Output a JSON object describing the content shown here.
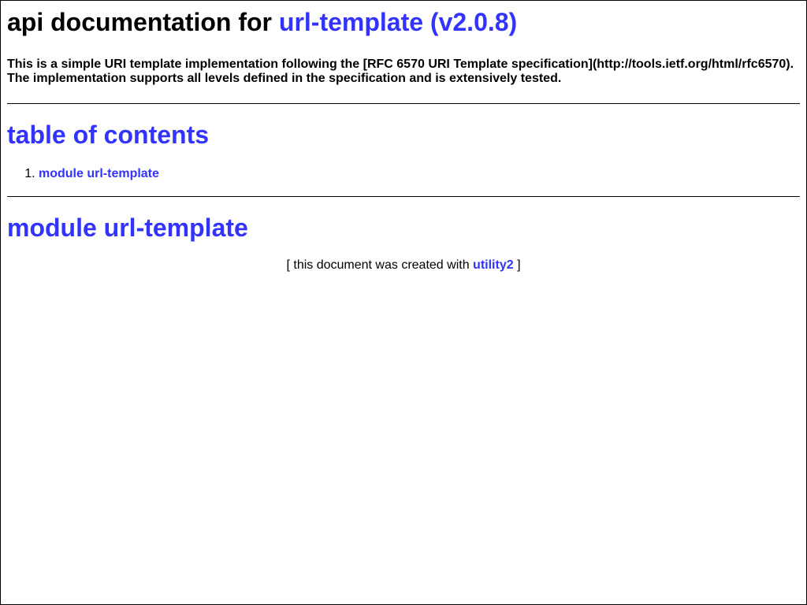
{
  "header": {
    "title_prefix": "api documentation for",
    "title_link": "url-template (v2.0.8)",
    "description_line1": "This is a simple URI template implementation following the [RFC 6570 URI Template specification](http://tools.ietf.org/html/rfc6570).",
    "description_line2": "The implementation supports all levels defined in the specification and is extensively tested."
  },
  "toc": {
    "heading": "table of contents",
    "items": [
      {
        "label": "module url-template"
      }
    ]
  },
  "module": {
    "heading": "module url-template"
  },
  "footer": {
    "prefix": "[ this document was created with",
    "link": "utility2",
    "suffix": "]"
  },
  "colors": {
    "link": "#3333ff"
  }
}
